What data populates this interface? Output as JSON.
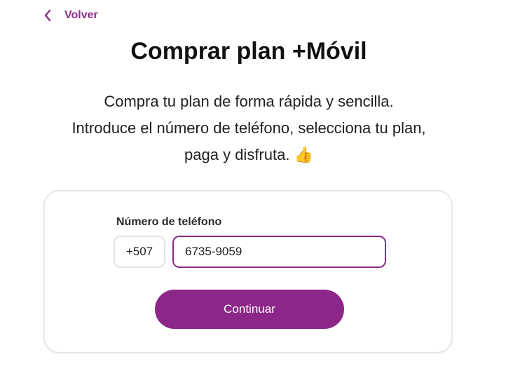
{
  "nav": {
    "back_label": "Volver",
    "back_icon": "chevron-left-icon"
  },
  "header": {
    "title": "Comprar plan +Móvil"
  },
  "intro": {
    "line1": "Compra tu plan de forma rápida y sencilla.",
    "line2": "Introduce el número de teléfono, selecciona tu plan,",
    "line3": "paga y disfruta. 👍"
  },
  "form": {
    "phone_label": "Número de teléfono",
    "country_code": "+507",
    "phone_value": "6735-9059",
    "continue_label": "Continuar"
  },
  "colors": {
    "accent": "#8a2a86",
    "button": "#8c2789",
    "card_border": "#e6e6e6"
  }
}
